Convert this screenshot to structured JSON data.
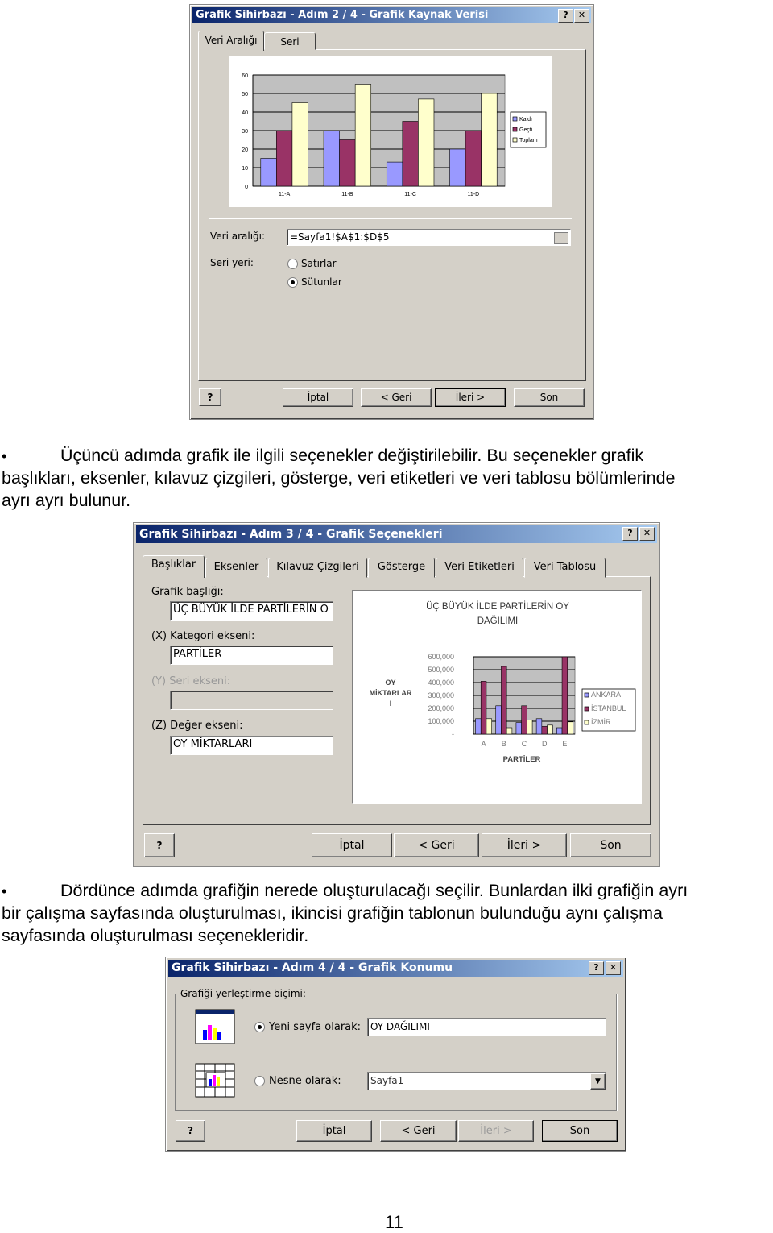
{
  "dialog2": {
    "title": "Grafik Sihirbazı - Adım 2 / 4 - Grafik Kaynak Verisi",
    "tabs": [
      "Veri Aralığı",
      "Seri"
    ],
    "data_range_label": "Veri aralığı:",
    "data_range_value": "=Sayfa1!$A$1:$D$5",
    "series_in_label": "Seri yeri:",
    "radio_rows": "Satırlar",
    "radio_columns": "Sütunlar",
    "selected": "Sütunlar",
    "buttons": {
      "cancel": "İptal",
      "back": "< Geri",
      "next": "İleri >",
      "finish": "Son"
    }
  },
  "chart1": {
    "type": "bar",
    "categories": [
      "11-A",
      "11-B",
      "11-C",
      "11-D"
    ],
    "series": [
      {
        "name": "Kaldı",
        "values": [
          15,
          30,
          13,
          20
        ],
        "color": "#9999ff"
      },
      {
        "name": "Geçti",
        "values": [
          30,
          25,
          35,
          30
        ],
        "color": "#993366"
      },
      {
        "name": "Toplam",
        "values": [
          45,
          55,
          47,
          50
        ],
        "color": "#ffffcc"
      }
    ],
    "ylim": [
      0,
      60
    ],
    "yticks": [
      "0",
      "10",
      "20",
      "30",
      "40",
      "50",
      "60"
    ],
    "grid": true,
    "legend": "right",
    "plot_bg": "#c0c0c0"
  },
  "text1": {
    "bullet": "•",
    "line1": "Üçüncü adımda grafik ile ilgili seçenekler değiştirilebilir. Bu seçenekler grafik",
    "line2": "başlıkları, eksenler, kılavuz çizgileri, gösterge, veri etiketleri ve veri tablosu bölümlerinde",
    "line3": "ayrı ayrı bulunur."
  },
  "dialog3": {
    "title": "Grafik Sihirbazı - Adım  3 / 4 - Grafik Seçenekleri",
    "tabs": [
      "Başlıklar",
      "Eksenler",
      "Kılavuz Çizgileri",
      "Gösterge",
      "Veri Etiketleri",
      "Veri Tablosu"
    ],
    "chart_title_label": "Grafik başlığı:",
    "chart_title_value": "ÜÇ BÜYÜK İLDE PARTİLERİN O",
    "x_label": "(X) Kategori ekseni:",
    "x_value": "PARTİLER",
    "y_label": "(Y) Seri ekseni:",
    "y_value": "",
    "z_label": "(Z) Değer ekseni:",
    "z_value": "OY MİKTARLARI",
    "buttons": {
      "cancel": "İptal",
      "back": "< Geri",
      "next": "İleri >",
      "finish": "Son"
    }
  },
  "chart2": {
    "type": "bar",
    "title_line1": "ÜÇ BÜYÜK İLDE PARTİLERİN OY",
    "title_line2": "DAĞILIMI",
    "ylabel_lines": [
      "OY",
      "MİKTARLAR",
      "I"
    ],
    "xlabel": "PARTİLER",
    "categories": [
      "A",
      "B",
      "C",
      "D",
      "E"
    ],
    "series": [
      {
        "name": "ANKARA",
        "values": [
          120000,
          220000,
          90000,
          120000,
          50000
        ],
        "color": "#9999ff"
      },
      {
        "name": "İSTANBUL",
        "values": [
          410000,
          525000,
          220000,
          60000,
          600000
        ],
        "color": "#993366"
      },
      {
        "name": "İZMİR",
        "values": [
          120000,
          50000,
          110000,
          70000,
          95000
        ],
        "color": "#ffffcc"
      }
    ],
    "ylim": [
      0,
      600000
    ],
    "yticks": [
      "-",
      "100,000",
      "200,000",
      "300,000",
      "400,000",
      "500,000",
      "600,000"
    ],
    "grid": true,
    "legend": "right",
    "plot_bg": "#c0c0c0"
  },
  "text2": {
    "bullet": "•",
    "line1": "Dördünce adımda grafiğin nerede oluşturulacağı seçilir. Bunlardan ilki grafiğin ayrı",
    "line2": "bir çalışma sayfasında oluşturulması, ikincisi grafiğin tablonun bulunduğu aynı çalışma",
    "line3": "sayfasında oluşturulması seçenekleridir."
  },
  "dialog4": {
    "title": "Grafik Sihirbazı - Adım 4 / 4 - Grafik Konumu",
    "group_label": "Grafiği yerleştirme biçimi:",
    "new_sheet_label": "Yeni sayfa olarak:",
    "new_sheet_value": "OY DAĞILIMI",
    "object_label": "Nesne olarak:",
    "object_value": "Sayfa1",
    "selected": "Yeni sayfa olarak:",
    "buttons": {
      "cancel": "İptal",
      "back": "< Geri",
      "next": "İleri >",
      "finish": "Son"
    }
  },
  "page_number": "11"
}
